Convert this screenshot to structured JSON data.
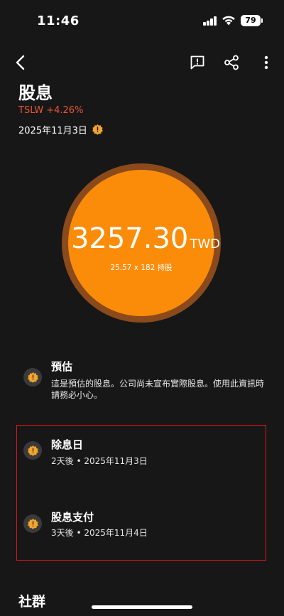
{
  "status_bar": {
    "time": "11:46",
    "battery": "79"
  },
  "header": {
    "title": "股息",
    "ticker_change": "TSLW +4.26%",
    "date": "2025年11月3日"
  },
  "summary": {
    "amount": "3257.30",
    "currency": "TWD",
    "shares_line": "25.57 x 182 持股"
  },
  "info": {
    "estimate": {
      "title": "預估",
      "text": "這是預估的股息。公司尚未宣布實際股息。使用此資訊時請務必小心。"
    },
    "ex_dividend": {
      "title": "除息日",
      "text": "2天後 • 2025年11月3日"
    },
    "payment": {
      "title": "股息支付",
      "text": "3天後 • 2025年11月4日"
    }
  },
  "section": {
    "social_title": "社群"
  },
  "colors": {
    "accent_orange": "#fb8c09",
    "ring": "#8a4a1b",
    "negative_red": "#e8563a",
    "highlight_red": "#e0161c",
    "background": "#171717"
  },
  "icons": [
    "back-icon",
    "report-icon",
    "share-icon",
    "more-icon",
    "warning-icon"
  ]
}
